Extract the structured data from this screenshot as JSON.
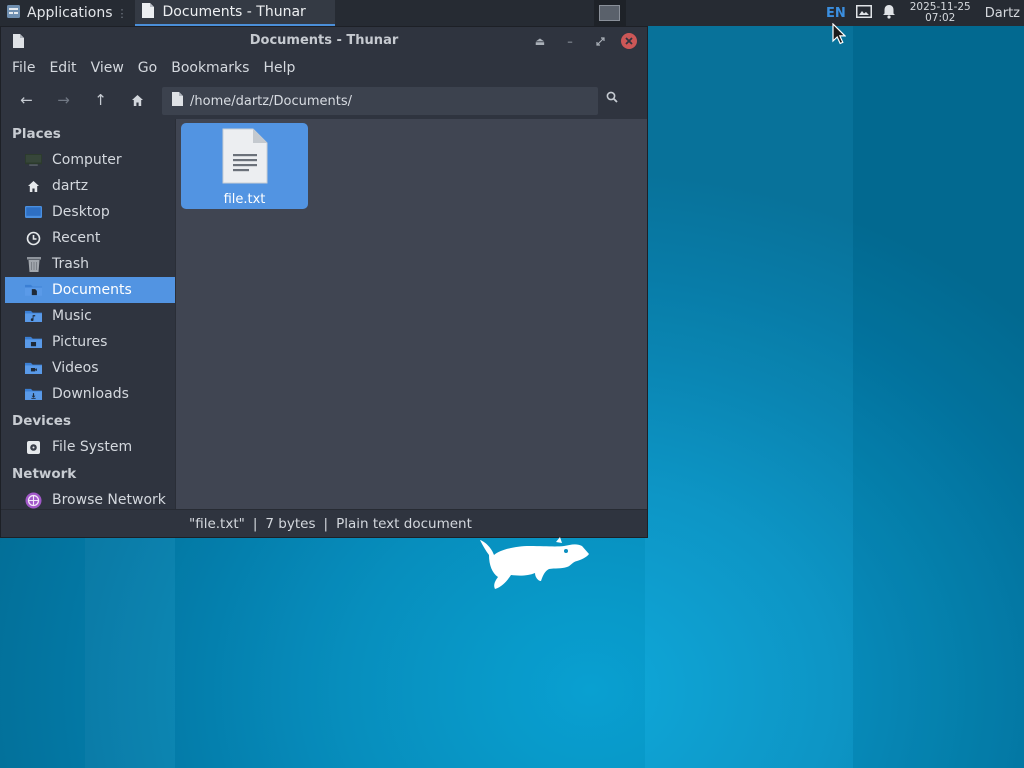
{
  "panel": {
    "apps_label": "Applications",
    "task_label": "Documents - Thunar",
    "lang": "EN",
    "date": "2025-11-25",
    "time": "07:02",
    "user": "Dartz"
  },
  "window": {
    "title": "Documents - Thunar",
    "menu": [
      "File",
      "Edit",
      "View",
      "Go",
      "Bookmarks",
      "Help"
    ],
    "path": "/home/dartz/Documents/"
  },
  "sidebar": {
    "places_header": "Places",
    "places": [
      "Computer",
      "dartz",
      "Desktop",
      "Recent",
      "Trash",
      "Documents",
      "Music",
      "Pictures",
      "Videos",
      "Downloads"
    ],
    "devices_header": "Devices",
    "devices": [
      "File System"
    ],
    "network_header": "Network",
    "network": [
      "Browse Network"
    ]
  },
  "files": [
    {
      "name": "file.txt"
    }
  ],
  "status": {
    "name": "\"file.txt\"",
    "size": "7 bytes",
    "type": "Plain text document"
  },
  "colors": {
    "accent": "#5294e2",
    "window_bg": "#2f343f",
    "content_bg": "#404552",
    "panel_bg": "#262b33",
    "close": "#cc5757"
  }
}
